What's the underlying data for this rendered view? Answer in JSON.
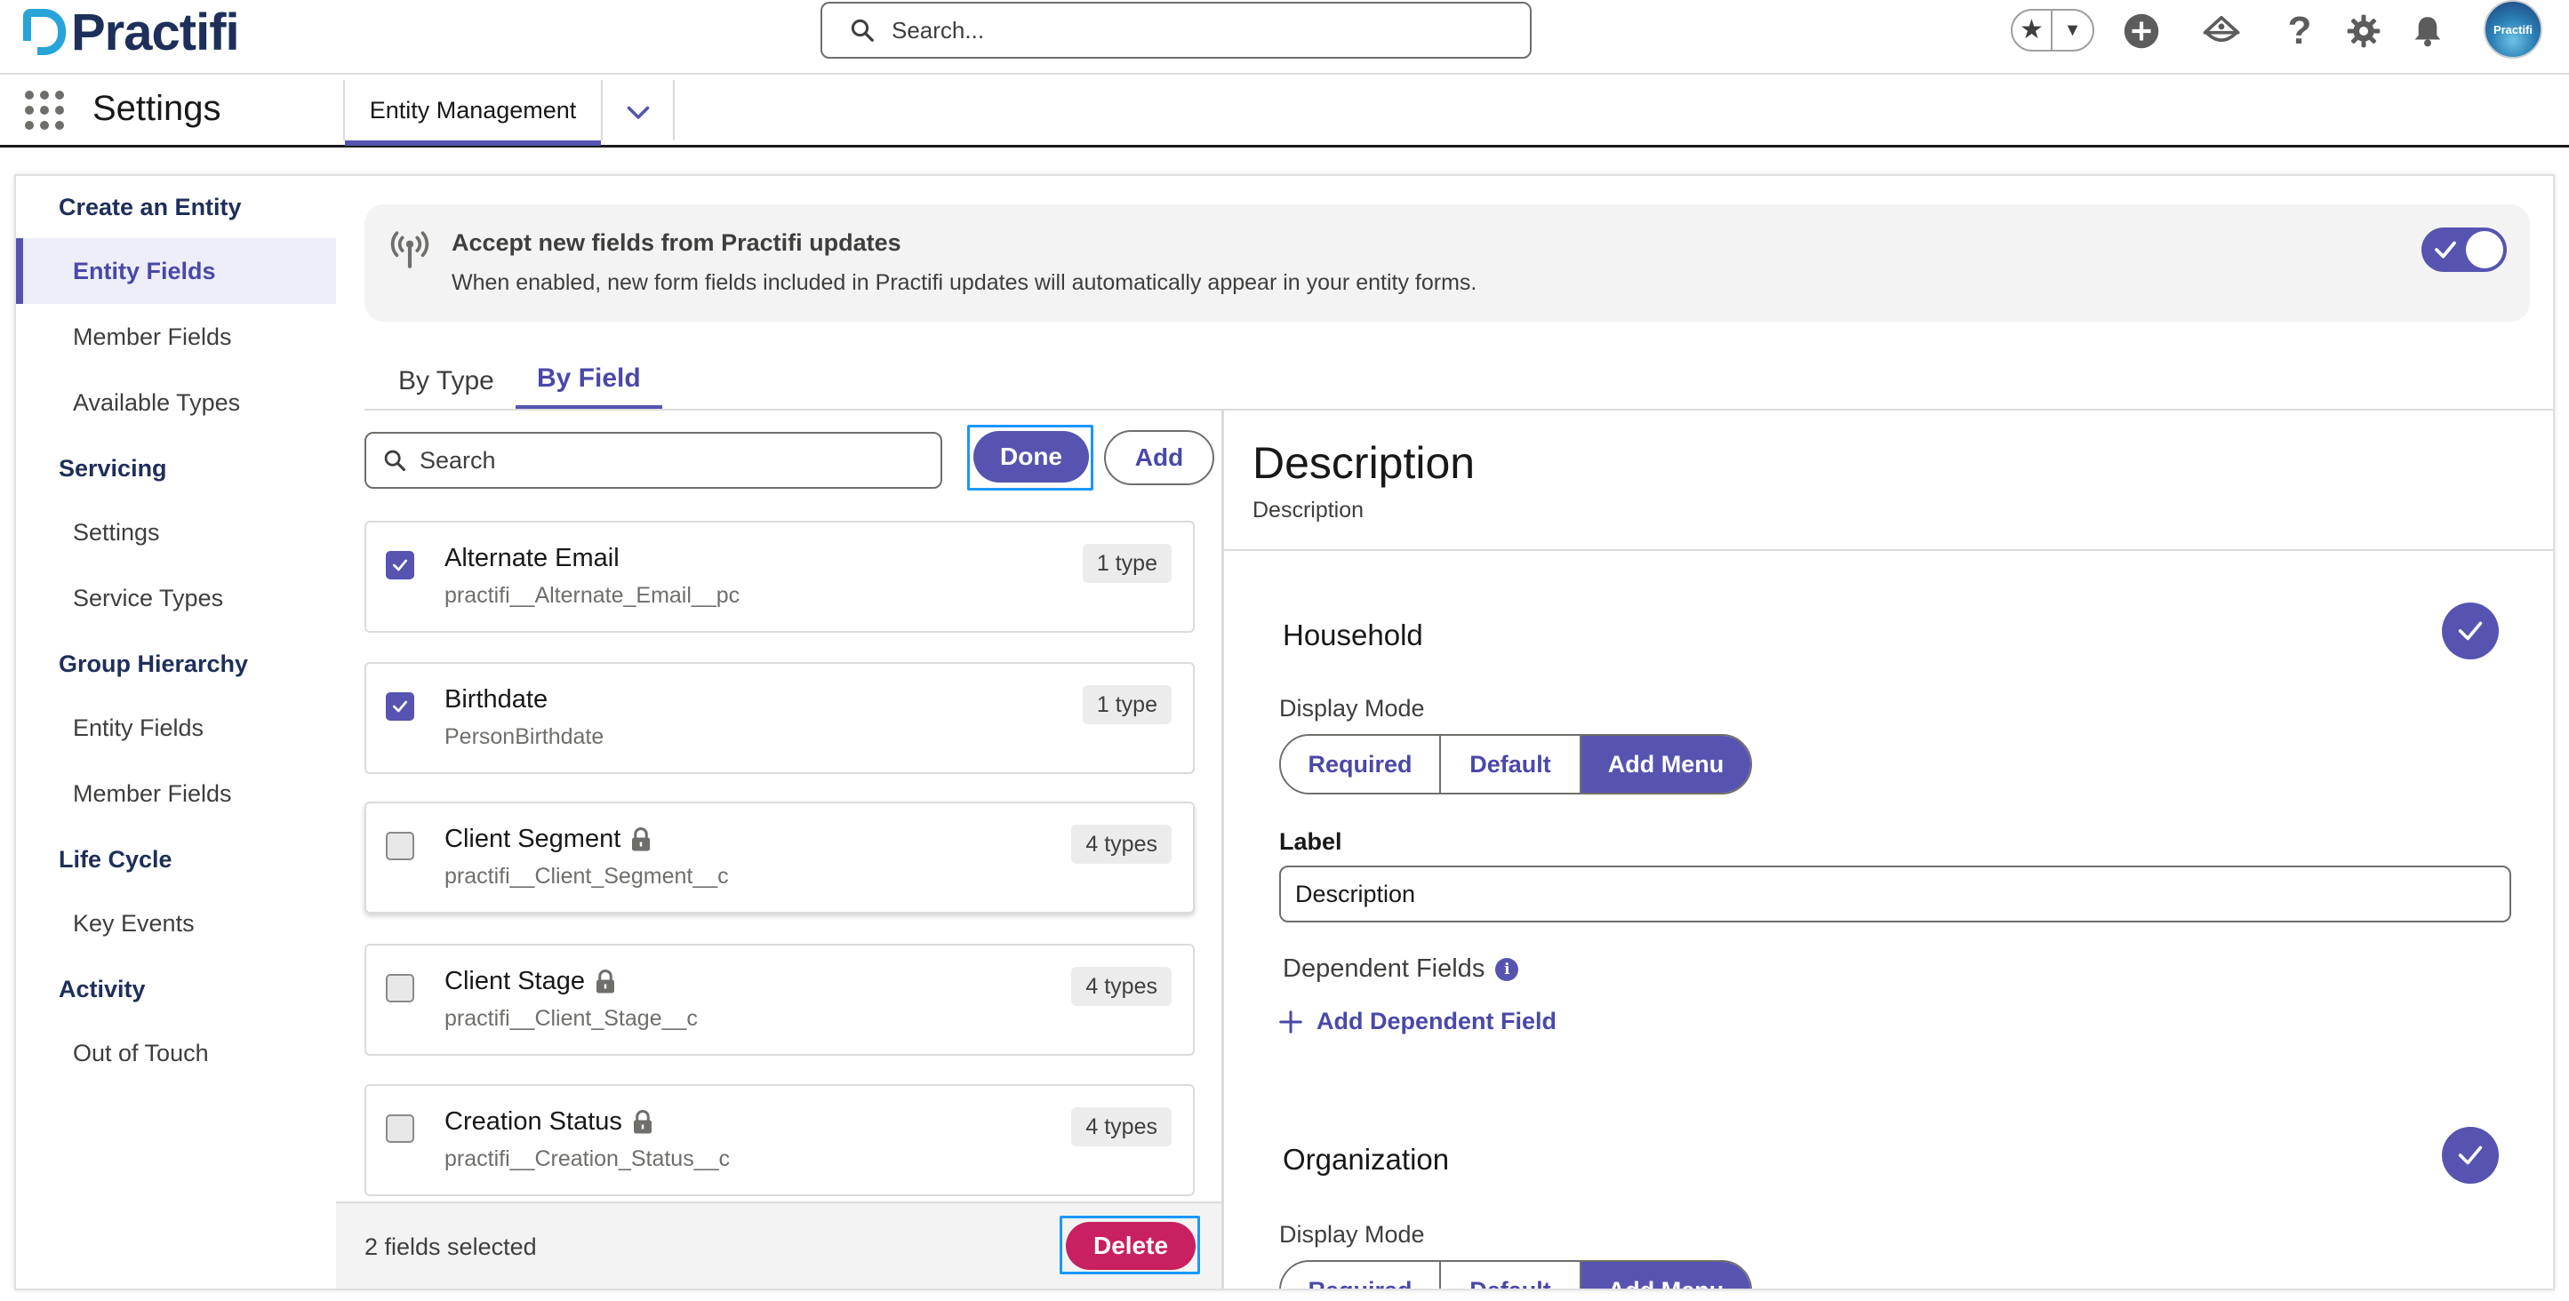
{
  "header": {
    "logo_text": "Practifi",
    "search_placeholder": "Search...",
    "avatar_text": "Practifi"
  },
  "app_nav": {
    "app_name": "Settings",
    "tab_label": "Entity Management"
  },
  "sidebar": {
    "groups": [
      {
        "title": "Create an Entity",
        "items": [
          "Entity Fields",
          "Member Fields",
          "Available Types"
        ]
      },
      {
        "title": "Servicing",
        "items": [
          "Settings",
          "Service Types"
        ]
      },
      {
        "title": "Group Hierarchy",
        "items": [
          "Entity Fields",
          "Member Fields"
        ]
      },
      {
        "title": "Life Cycle",
        "items": [
          "Key Events"
        ]
      },
      {
        "title": "Activity",
        "items": [
          "Out of Touch"
        ]
      }
    ],
    "active_item": "Entity Fields"
  },
  "banner": {
    "title": "Accept new fields from Practifi updates",
    "description": "When enabled, new form fields included in Practifi updates will automatically appear in your entity forms.",
    "toggle_on": true
  },
  "tabs": [
    {
      "label": "By Type",
      "active": false
    },
    {
      "label": "By Field",
      "active": true
    }
  ],
  "field_list": {
    "search_placeholder": "Search",
    "done_label": "Done",
    "add_label": "Add",
    "fields": [
      {
        "name": "Alternate Email",
        "api": "practifi__Alternate_Email__pc",
        "types": "1 type",
        "checked": true,
        "locked": false
      },
      {
        "name": "Birthdate",
        "api": "PersonBirthdate",
        "types": "1 type",
        "checked": true,
        "locked": false
      },
      {
        "name": "Client Segment",
        "api": "practifi__Client_Segment__c",
        "types": "4 types",
        "checked": false,
        "locked": true
      },
      {
        "name": "Client Stage",
        "api": "practifi__Client_Stage__c",
        "types": "4 types",
        "checked": false,
        "locked": true
      },
      {
        "name": "Creation Status",
        "api": "practifi__Creation_Status__c",
        "types": "4 types",
        "checked": false,
        "locked": true
      }
    ],
    "selected_text": "2 fields selected",
    "delete_label": "Delete"
  },
  "detail": {
    "title": "Description",
    "subtitle": "Description",
    "sections": [
      {
        "name": "Household",
        "display_mode_label": "Display Mode",
        "modes": [
          "Required",
          "Default",
          "Add Menu"
        ],
        "selected_mode": "Add Menu",
        "label_title": "Label",
        "label_value": "Description",
        "dependent_title": "Dependent Fields",
        "add_dependent_label": "Add Dependent Field"
      },
      {
        "name": "Organization",
        "display_mode_label": "Display Mode",
        "modes": [
          "Required",
          "Default",
          "Add Menu"
        ],
        "selected_mode": "Add Menu"
      }
    ]
  },
  "colors": {
    "brand": "#5654b0",
    "danger": "#c82060",
    "logo_accent": "#27a4d8",
    "logo_text": "#1e2f5a"
  }
}
